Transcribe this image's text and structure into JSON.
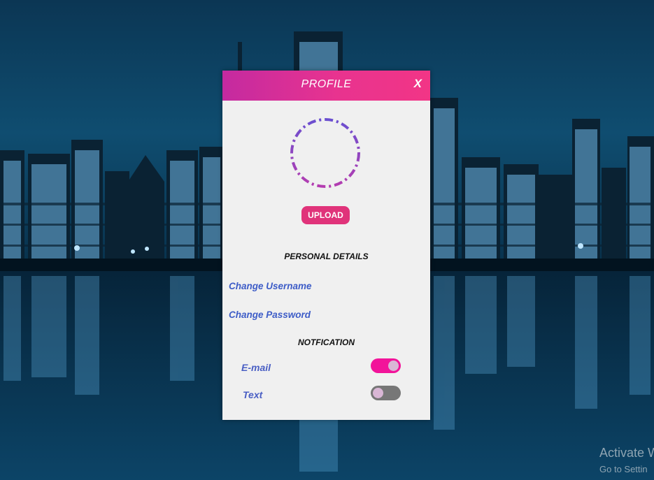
{
  "background": {
    "description_icon": "city-skyline-night-reflection"
  },
  "window": {
    "title": "PROFILE",
    "close_label": "X",
    "header_colors": [
      "#c42aa0",
      "#f23586"
    ]
  },
  "avatar": {
    "icon": "avatar-placeholder-circle",
    "colors": [
      "#6a4fd0",
      "#b43cb0"
    ]
  },
  "upload_button": {
    "label": "UPLOAD",
    "color": "#e0337a"
  },
  "personal_details": {
    "heading": "PERSONAL DETAILS",
    "links": [
      {
        "label": "Change Username"
      },
      {
        "label": "Change Password"
      }
    ]
  },
  "notification": {
    "heading": "NOTFICATION",
    "options": [
      {
        "label": "E-mail",
        "enabled": true
      },
      {
        "label": "Text",
        "enabled": false
      }
    ],
    "toggle_on_color": "#f2149a",
    "toggle_off_color": "#777777"
  },
  "os_watermark": {
    "title": "Activate W",
    "subtitle": "Go to Settin"
  }
}
